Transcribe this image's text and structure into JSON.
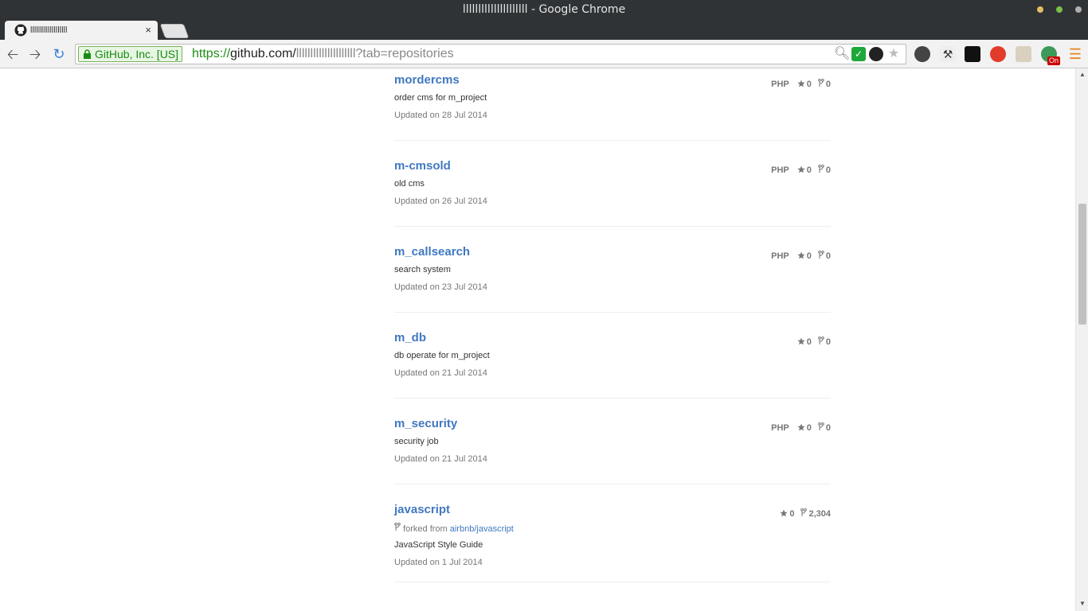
{
  "window": {
    "title": "lllllllllllllllllllll - Google Chrome"
  },
  "tab": {
    "title": "lllllllllllllllllll",
    "close": "×"
  },
  "omnibox": {
    "ev_label": "GitHub, Inc. [US]",
    "scheme": "https://",
    "host": "github.com/",
    "path": "lllllllllllllllllllll?tab=repositories"
  },
  "extensions": {
    "badge": "On"
  },
  "colors": {
    "link": "#4078c0",
    "muted": "#777777",
    "ev_green": "#178c14"
  },
  "repos": [
    {
      "name": "mordercms",
      "description": "order cms for m_project",
      "updated": "Updated on 28 Jul 2014",
      "language": "PHP",
      "stars": "0",
      "forks": "0"
    },
    {
      "name": "m-cmsold",
      "description": "old cms",
      "updated": "Updated on 26 Jul 2014",
      "language": "PHP",
      "stars": "0",
      "forks": "0"
    },
    {
      "name": "m_callsearch",
      "description": "search system",
      "updated": "Updated on 23 Jul 2014",
      "language": "PHP",
      "stars": "0",
      "forks": "0"
    },
    {
      "name": "m_db",
      "description": "db operate for m_project",
      "updated": "Updated on 21 Jul 2014",
      "language": "",
      "stars": "0",
      "forks": "0"
    },
    {
      "name": "m_security",
      "description": "security job",
      "updated": "Updated on 21 Jul 2014",
      "language": "PHP",
      "stars": "0",
      "forks": "0"
    },
    {
      "name": "javascript",
      "forked_prefix": "forked from ",
      "forked_from": "airbnb/javascript",
      "description": "JavaScript Style Guide",
      "updated": "Updated on 1 Jul 2014",
      "language": "",
      "stars": "0",
      "forks": "2,304"
    }
  ]
}
